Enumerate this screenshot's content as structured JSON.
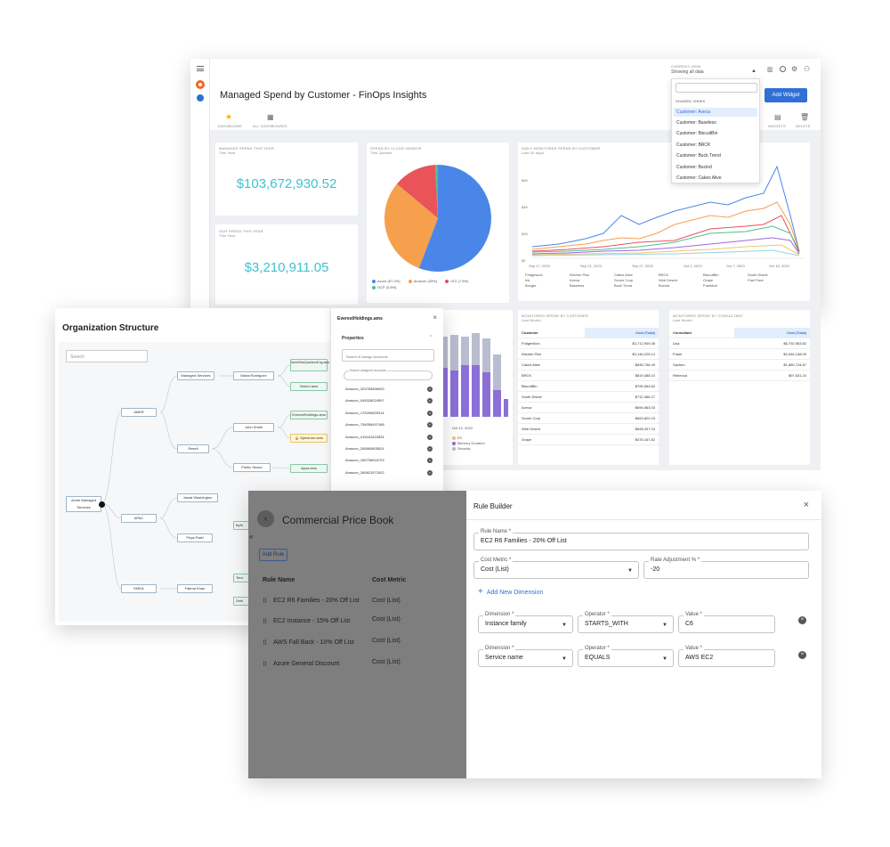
{
  "dashboard": {
    "title": "Managed Spend by Customer - FinOps Insights",
    "current_view_label": "CURRENT VIEW",
    "current_view_value": "Showing all data",
    "add_widget": "Add Widget",
    "tabs": [
      "DASHBOARD",
      "ALL DASHBOARDS"
    ],
    "right_actions": [
      "WIDGETS",
      "DELETE"
    ],
    "dropdown": {
      "section": "SHARED VIEWS",
      "items": [
        "Customer: Aveca",
        "Customer: Baseless",
        "Customer: BiscuitBin",
        "Customer: BRCK",
        "Customer: Buck Trend",
        "Customer: Bucind",
        "Customer: Cakes Alive"
      ],
      "selected_index": 0
    },
    "managed_spend": {
      "label": "MANAGED SPEND THIS YEAR",
      "sub": "This Year",
      "value": "$103,672,930.52"
    },
    "our_spend": {
      "label": "OUR SPEND THIS YEAR",
      "sub": "This Year",
      "value": "$3,210,911.05"
    },
    "vendor": {
      "label": "SPEND BY CLOUD VENDOR",
      "sub": "This Quarter",
      "legend": [
        "Azure (57.2%)",
        "Amazon (33%)",
        "OCI (7.5%)",
        "GCP (0.8%)"
      ]
    },
    "daily": {
      "label": "DAILY MONITORED SPEND BY CUSTOMER",
      "sub": "Last 30 days",
      "y_ticks": [
        "$6K",
        "$4K",
        "$2K",
        "$0"
      ],
      "x_ticks": [
        "Sep 17, 2023",
        "Sep 21, 2023",
        "Sep 27, 2023",
        "Oct 1, 2023",
        "Oct 7, 2023",
        "Oct 15, 2023"
      ],
      "legend": [
        "Fridgeworx",
        "Kitchen Plus",
        "Cakes Alive",
        "BRCK",
        "BiscuitBin",
        "South Divide",
        "Iris",
        "Aveca",
        "Scone Corp",
        "Web Desert",
        "Grape",
        "Fast Face",
        "Boogie",
        "Baseless",
        "Buck Trend",
        "Bucind",
        "Frankfurt"
      ]
    },
    "monitored_customer": {
      "label": "MONITORED SPEND BY CUSTOMER",
      "sub": "Last Month",
      "headers": [
        "Customer",
        "Cost (Total)"
      ],
      "rows": [
        [
          "FridgeWorx",
          "$3,712,909.38"
        ],
        [
          "Kitchen Plus",
          "$3,146,225.14"
        ],
        [
          "Cakes Alive",
          "$835,756.49"
        ],
        [
          "BRCK",
          "$819,388.10"
        ],
        [
          "BiscuitBin",
          "$796,564.82"
        ],
        [
          "South Divide",
          "$712,366.27"
        ],
        [
          "Aveca",
          "$694,863.03"
        ],
        [
          "Scone Corp",
          "$663,820.15"
        ],
        [
          "Web Desert",
          "$628,437.24"
        ],
        [
          "Grape",
          "$475,447.82"
        ]
      ]
    },
    "monitored_consultant": {
      "label": "MONITORED SPEND BY CONSULTANT",
      "sub": "Last Month",
      "headers": [
        "Consultant",
        "Cost (Total)"
      ],
      "rows": [
        [
          "Lisa",
          "$6,792,983.82"
        ],
        [
          "Frank",
          "$2,064,138.09"
        ],
        [
          "Sachen",
          "$1,880,734.87"
        ],
        [
          "Rebecca",
          "$97,631.24"
        ]
      ]
    },
    "bar_legend": [
      "EC",
      "Memory Duration",
      "Security"
    ],
    "bar_date": "Oct 12, 2023"
  },
  "org": {
    "title": "Organization Structure",
    "search_placeholder": "Search",
    "nodes": {
      "root": "Acme Managed Services",
      "amer": "AMER",
      "apac": "APAC",
      "emea": "EMEA",
      "managed": "Managed Services",
      "maria": "Maria Rodriguez",
      "northstar": "NorthStarQuantumEng.ams",
      "visiont": "VisionI.ams",
      "resell": "Resell",
      "john": "John Smith",
      "everest": "EverestHoldings.ams",
      "spectrum": "Spectrum.ams",
      "public": "Public Sector",
      "nipsa": "nipsa.ams",
      "jamal": "Jamal Washington",
      "priya": "Priya Patel",
      "fatima": "Fatima Khan",
      "partial1": "Byth",
      "partial2": "Tera",
      "partial3": "Zeth"
    },
    "panel": {
      "title": "EverestHoldings.ams",
      "close": "×",
      "properties": "Properties",
      "assign_placeholder": "Search & Assign Accounts",
      "search_assigned": "Search assigned accounts",
      "accounts": [
        "Amazon_325783656903",
        "Amazon_948328024597",
        "Amazon_176290839314",
        "Amazon_754056497168",
        "Amazon_415181622834",
        "Amazon_265660805524",
        "Amazon_165736516723",
        "Amazon_280821572402"
      ]
    }
  },
  "pricebook": {
    "title": "Commercial Price Book",
    "add_rule": "Add Rule",
    "headers": [
      "Rule Name",
      "Cost Metric"
    ],
    "rules": [
      {
        "name": "EC2 R6 Families - 20% Off List",
        "metric": "Cost (List)"
      },
      {
        "name": "EC2 Instance - 15% Off List",
        "metric": "Cost (List)"
      },
      {
        "name": "AWS Fall Back - 10% Off List",
        "metric": "Cost (List)"
      },
      {
        "name": "Azure General Discount",
        "metric": "Cost (List)"
      }
    ],
    "builder": {
      "title": "Rule Builder",
      "close": "×",
      "rule_name_label": "Rule Name *",
      "rule_name": "EC2 R6 Families - 20% Off List",
      "cost_metric_label": "Cost Metric *",
      "cost_metric": "Cost (List)",
      "rate_label": "Rate Adjustment % *",
      "rate": "-20",
      "add_dimension": "Add New Dimension",
      "dimension_label": "Dimension *",
      "operator_label": "Operator *",
      "value_label": "Value *",
      "dimensions": [
        {
          "dimension": "Instance family",
          "operator": "STARTS_WITH",
          "value": "C6"
        },
        {
          "dimension": "Service name",
          "operator": "EQUALS",
          "value": "AWS EC2"
        }
      ]
    }
  },
  "colors": {
    "accent": "#2f6fd6",
    "teal": "#3ec3cf",
    "azure": "#4a86e8",
    "amazon": "#f6a04d",
    "oci": "#e8545a",
    "gcp": "#4fc08d"
  }
}
